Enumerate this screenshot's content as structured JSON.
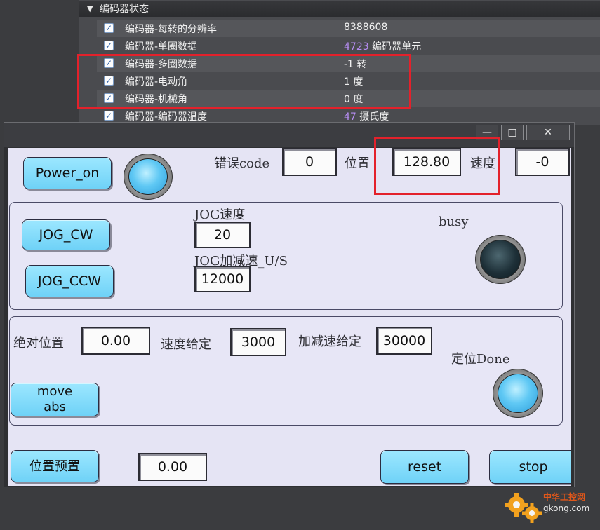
{
  "encoder_panel": {
    "header": "编码器状态",
    "rows": [
      {
        "label": "编码器-每转的分辨率",
        "number": "",
        "value": "8388608",
        "checked": true
      },
      {
        "label": "编码器-单圈数据",
        "number": "4723",
        "value": "编码器单元",
        "checked": true
      },
      {
        "label": "编码器-多圈数据",
        "number": "",
        "value": "-1 转",
        "checked": true
      },
      {
        "label": "编码器-电动角",
        "number": "",
        "value": "1 度",
        "checked": true
      },
      {
        "label": "编码器-机械角",
        "number": "",
        "value": "0 度",
        "checked": true
      },
      {
        "label": "编码器-编码器温度",
        "number": "47",
        "value": "摄氏度",
        "checked": true
      }
    ]
  },
  "dialog": {
    "title_buttons": {
      "minimize": "—",
      "maximize": "□",
      "close": "✕"
    },
    "top": {
      "power_on": "Power_on",
      "error_label": "错误code",
      "error_value": "0",
      "position_label": "位置",
      "position_value": "128.80",
      "speed_label": "速度",
      "speed_value": "-0"
    },
    "jog": {
      "cw": "JOG_CW",
      "ccw": "JOG_CCW",
      "speed_label": "JOG速度",
      "speed_value": "20",
      "acc_label": "JOG加减速_U/S",
      "acc_value": "12000",
      "busy_label": "busy"
    },
    "move": {
      "abs_pos_label": "绝对位置",
      "abs_pos_value": "0.00",
      "speed_label": "速度给定",
      "speed_value": "3000",
      "acc_label": "加减速给定",
      "acc_value": "30000",
      "done_label": "定位Done",
      "move_abs": "move\nabs"
    },
    "bottom": {
      "preset": "位置预置",
      "preset_value": "0.00",
      "reset": "reset",
      "stop": "stop"
    }
  },
  "watermark": {
    "site": "中华工控网",
    "url": "gkong.com"
  },
  "colors": {
    "highlight_red": "#e3212b",
    "button_cyan": "#7fdbfa",
    "lamp_on": "#5fc8f4",
    "lamp_off": "#1e3038"
  }
}
